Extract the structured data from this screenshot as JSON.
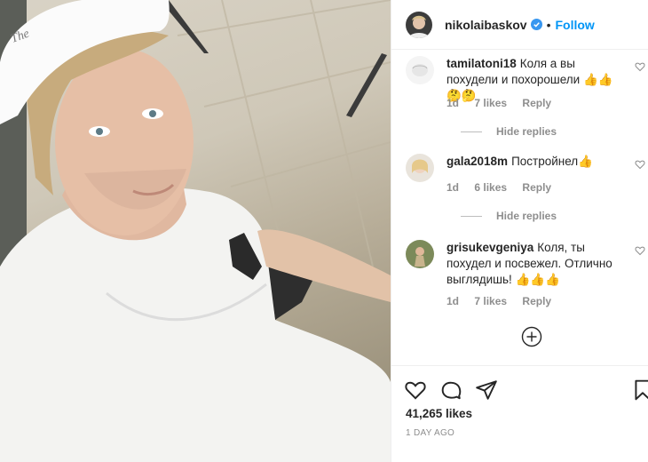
{
  "header": {
    "username": "nikolaibaskov",
    "dot": "•",
    "follow_label": "Follow"
  },
  "comments": [
    {
      "username": "tamilatoni18",
      "text": "Коля а вы похудели и похорошели 👍👍🤔🤔",
      "age": "1d",
      "likes": "7 likes",
      "reply": "Reply",
      "hide_replies": "Hide replies"
    },
    {
      "username": "gala2018m",
      "text": "Постройнел👍",
      "age": "1d",
      "likes": "6 likes",
      "reply": "Reply",
      "hide_replies": "Hide replies"
    },
    {
      "username": "grisukevgeniya",
      "text": "Коля, ты похудел и посвежел. Отлично выглядишь! 👍👍👍",
      "age": "1d",
      "likes": "7 likes",
      "reply": "Reply"
    }
  ],
  "footer": {
    "likes": "41,265 likes",
    "time_ago": "1 DAY AGO"
  },
  "colors": {
    "accent": "#0095f6",
    "muted": "#8e8e8e",
    "text": "#262626"
  },
  "icons": [
    "heart-icon",
    "comment-icon",
    "share-icon",
    "bookmark-icon",
    "verified-icon",
    "load-more-icon"
  ]
}
